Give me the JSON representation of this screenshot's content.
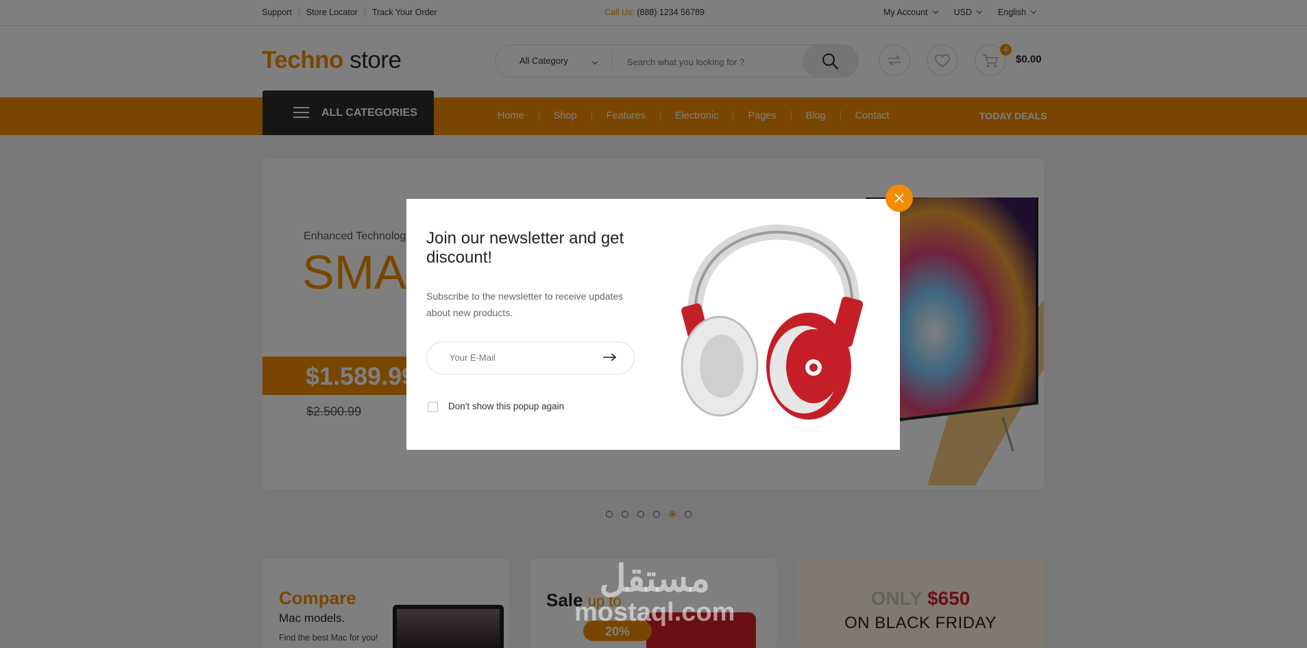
{
  "topbar": {
    "links": [
      "Support",
      "Store Locator",
      "Track Your Order"
    ],
    "call_label": "Call Us:",
    "call_number": "(888) 1234 56789",
    "account": "My Account",
    "currency": "USD",
    "language": "English"
  },
  "header": {
    "logo_part1": "Techno",
    "logo_part2": "store",
    "category_select": "All Category",
    "search_placeholder": "Search what you looking for ?",
    "cart_count": "4",
    "cart_total": "$0.00"
  },
  "nav": {
    "all_categories": "ALL CATEGORIES",
    "items": [
      "Home",
      "Shop",
      "Features",
      "Electronic",
      "Pages",
      "Blog",
      "Contact"
    ],
    "today_deals": "TODAY DEALS"
  },
  "hero": {
    "eyebrow": "Enhanced Technology",
    "headline": "SMA",
    "price": "$1.589.99",
    "old_price": "$2.500.99",
    "slides": 6,
    "active_slide": 5
  },
  "promos": {
    "compare_title": "Compare",
    "compare_sub": "Mac models.",
    "compare_text": "Find the best Mac for you!",
    "sale_title": "Sale",
    "sale_upto": "up to",
    "sale_pct": "20%",
    "blackfriday_only": "ONLY",
    "blackfriday_price": "$650",
    "blackfriday_sub": "ON BLACK FRIDAY"
  },
  "watermark": {
    "arabic": "مستقل",
    "latin": "mostaql.com"
  },
  "popup": {
    "title": "Join our newsletter and get discount!",
    "description": "Subscribe to the newsletter to receive updates about new products.",
    "email_placeholder": "Your E-Mail",
    "dont_show": "Don't show this popup again"
  },
  "colors": {
    "accent": "#f28c00",
    "dark": "#2d2d2d",
    "red": "#d52028"
  }
}
